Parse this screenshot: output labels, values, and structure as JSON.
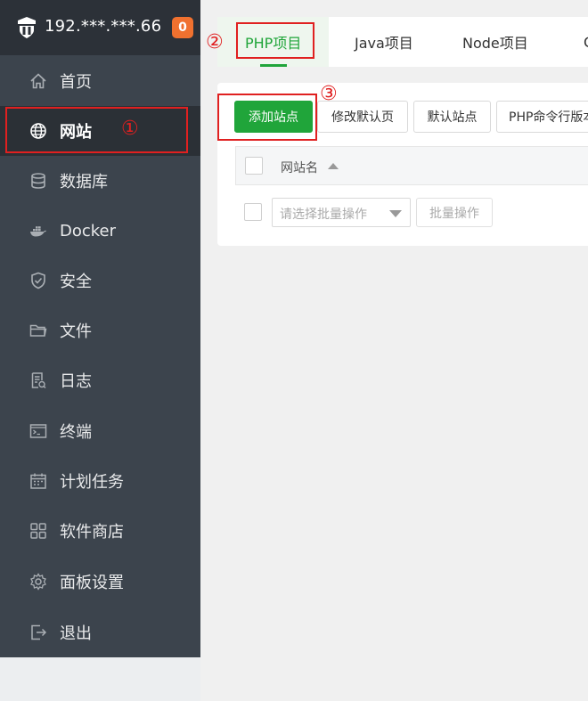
{
  "header": {
    "host": "192.***.***.66",
    "badge": "0"
  },
  "sidebar": {
    "items": [
      {
        "label": "首页",
        "icon": "home-icon"
      },
      {
        "label": "网站",
        "icon": "globe-icon",
        "active": true
      },
      {
        "label": "数据库",
        "icon": "database-icon"
      },
      {
        "label": "Docker",
        "icon": "docker-icon"
      },
      {
        "label": "安全",
        "icon": "shield-icon"
      },
      {
        "label": "文件",
        "icon": "folder-icon"
      },
      {
        "label": "日志",
        "icon": "log-icon"
      },
      {
        "label": "终端",
        "icon": "terminal-icon"
      },
      {
        "label": "计划任务",
        "icon": "calendar-icon"
      },
      {
        "label": "软件商店",
        "icon": "apps-icon"
      },
      {
        "label": "面板设置",
        "icon": "gear-icon"
      },
      {
        "label": "退出",
        "icon": "logout-icon"
      }
    ]
  },
  "annotations": {
    "one": "①",
    "two": "②",
    "three": "③"
  },
  "tabs": [
    {
      "label": "PHP项目",
      "active": true
    },
    {
      "label": "Java项目"
    },
    {
      "label": "Node项目"
    },
    {
      "label": "C"
    }
  ],
  "toolbar": {
    "add_site": "添加站点",
    "edit_default_page": "修改默认页",
    "default_site": "默认站点",
    "php_cli_version": "PHP命令行版本"
  },
  "table": {
    "header_site_name": "网站名",
    "batch_placeholder": "请选择批量操作",
    "batch_button": "批量操作"
  },
  "colors": {
    "accent": "#20a53a",
    "sidebar": "#3c444d",
    "badge": "#f0712f",
    "annotation": "#e02020"
  }
}
